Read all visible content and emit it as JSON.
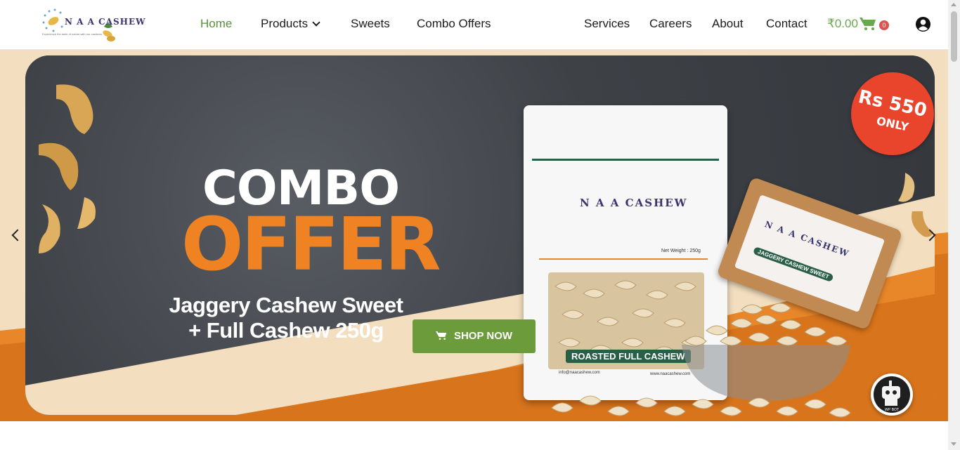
{
  "brand": {
    "name": "N A A CASHEW",
    "tagline": "Experience the taste of nature with our cashews"
  },
  "nav": {
    "left": [
      {
        "label": "Home",
        "active": true
      },
      {
        "label": "Products",
        "dropdown": true
      },
      {
        "label": "Sweets"
      },
      {
        "label": "Combo Offers"
      }
    ],
    "right": [
      {
        "label": "Services"
      },
      {
        "label": "Careers"
      },
      {
        "label": "About"
      },
      {
        "label": "Contact"
      }
    ]
  },
  "cart": {
    "total": "₹0.00",
    "count": "0",
    "icon": "cart-icon"
  },
  "hero": {
    "headline_top": "COMBO",
    "headline_bottom": "OFFER",
    "subline_1": "Jaggery Cashew Sweet",
    "subline_2": "+ Full Cashew 250g",
    "cta_label": "SHOP NOW",
    "price_badge_main": "Rs 550",
    "price_badge_sub": "ONLY",
    "pouch_brand": "N A A CASHEW",
    "pouch_weight": "Net Weight : 250g",
    "pouch_label": "ROASTED FULL CASHEW",
    "pouch_email": "info@naacashew.com",
    "pouch_web": "www.naacashew.com",
    "box_brand": "N A A CASHEW",
    "box_label": "JAGGERY CASHEW SWEET"
  },
  "colors": {
    "accent_green": "#6b9b3a",
    "nav_active": "#5a8f3c",
    "offer_orange": "#ef8222",
    "badge_red": "#e9442c"
  },
  "chatbot": {
    "label": "WP BOT"
  }
}
